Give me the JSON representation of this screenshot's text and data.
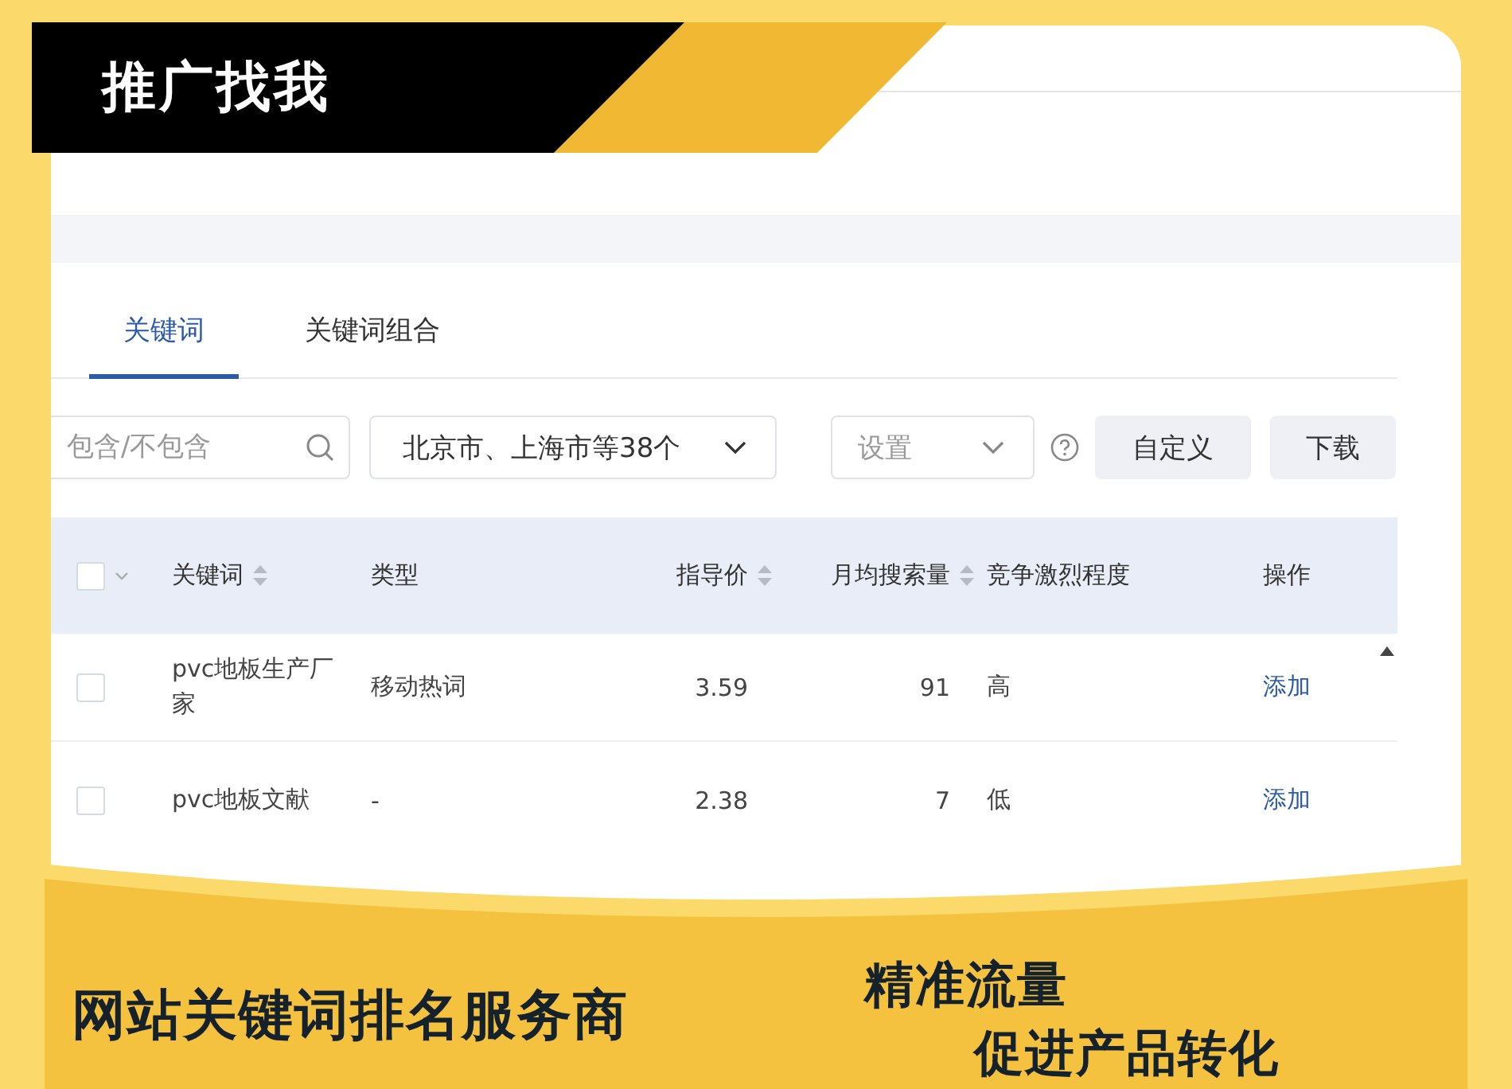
{
  "banner": {
    "title": "推广找我"
  },
  "tabs": [
    {
      "label": "关键词",
      "selected": true
    },
    {
      "label": "关键词组合",
      "selected": false
    }
  ],
  "toolbar": {
    "search": {
      "placeholder": "包含/不包含"
    },
    "region_select": {
      "value": "北京市、上海市等38个"
    },
    "settings_select": {
      "placeholder": "设置"
    },
    "buttons": [
      "自定义",
      "下载"
    ]
  },
  "table": {
    "select_all": {
      "checked": false
    },
    "columns": [
      {
        "label": "关键词",
        "kind": "text",
        "sortable": true
      },
      {
        "label": "类型",
        "kind": "text",
        "sortable": false
      },
      {
        "label": "指导价",
        "kind": "number",
        "sortable": true
      },
      {
        "label": "月均搜索量",
        "kind": "number",
        "sortable": true
      },
      {
        "label": "竞争激烈程度",
        "kind": "text",
        "sortable": false
      },
      {
        "label": "操作",
        "kind": "action",
        "sortable": false
      }
    ],
    "rows": [
      {
        "checked": false,
        "cells": [
          "pvc地板生产厂家",
          "移动热词",
          "3.59",
          "91",
          "高",
          "添加"
        ]
      },
      {
        "checked": false,
        "cells": [
          "pvc地板文献",
          "-",
          "2.38",
          "7",
          "低",
          "添加"
        ]
      }
    ]
  },
  "footer": {
    "headline": "网站关键词排名服务商",
    "slogan_lines": [
      "精准流量",
      "促进产品转化"
    ]
  }
}
